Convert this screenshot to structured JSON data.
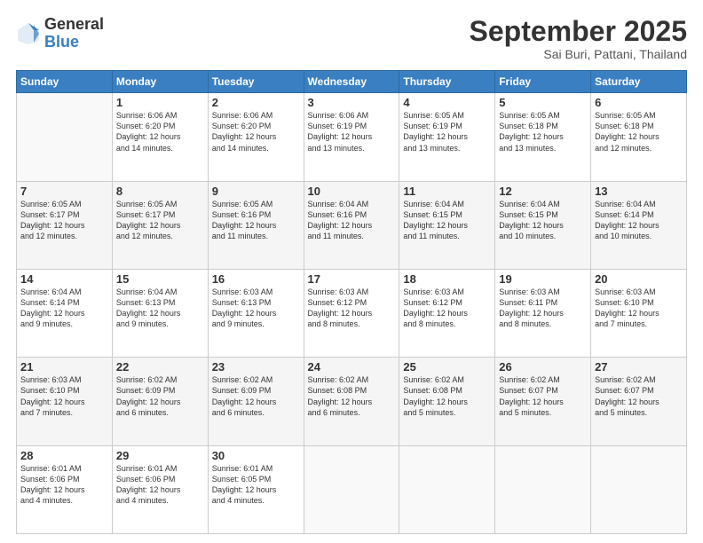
{
  "logo": {
    "general": "General",
    "blue": "Blue"
  },
  "header": {
    "month": "September 2025",
    "location": "Sai Buri, Pattani, Thailand"
  },
  "weekdays": [
    "Sunday",
    "Monday",
    "Tuesday",
    "Wednesday",
    "Thursday",
    "Friday",
    "Saturday"
  ],
  "weeks": [
    [
      {
        "day": null
      },
      {
        "day": 1,
        "sunrise": "6:06 AM",
        "sunset": "6:20 PM",
        "daylight": "12 hours and 14 minutes."
      },
      {
        "day": 2,
        "sunrise": "6:06 AM",
        "sunset": "6:20 PM",
        "daylight": "12 hours and 14 minutes."
      },
      {
        "day": 3,
        "sunrise": "6:06 AM",
        "sunset": "6:19 PM",
        "daylight": "12 hours and 13 minutes."
      },
      {
        "day": 4,
        "sunrise": "6:05 AM",
        "sunset": "6:19 PM",
        "daylight": "12 hours and 13 minutes."
      },
      {
        "day": 5,
        "sunrise": "6:05 AM",
        "sunset": "6:18 PM",
        "daylight": "12 hours and 13 minutes."
      },
      {
        "day": 6,
        "sunrise": "6:05 AM",
        "sunset": "6:18 PM",
        "daylight": "12 hours and 12 minutes."
      }
    ],
    [
      {
        "day": 7,
        "sunrise": "6:05 AM",
        "sunset": "6:17 PM",
        "daylight": "12 hours and 12 minutes."
      },
      {
        "day": 8,
        "sunrise": "6:05 AM",
        "sunset": "6:17 PM",
        "daylight": "12 hours and 12 minutes."
      },
      {
        "day": 9,
        "sunrise": "6:05 AM",
        "sunset": "6:16 PM",
        "daylight": "12 hours and 11 minutes."
      },
      {
        "day": 10,
        "sunrise": "6:04 AM",
        "sunset": "6:16 PM",
        "daylight": "12 hours and 11 minutes."
      },
      {
        "day": 11,
        "sunrise": "6:04 AM",
        "sunset": "6:15 PM",
        "daylight": "12 hours and 11 minutes."
      },
      {
        "day": 12,
        "sunrise": "6:04 AM",
        "sunset": "6:15 PM",
        "daylight": "12 hours and 10 minutes."
      },
      {
        "day": 13,
        "sunrise": "6:04 AM",
        "sunset": "6:14 PM",
        "daylight": "12 hours and 10 minutes."
      }
    ],
    [
      {
        "day": 14,
        "sunrise": "6:04 AM",
        "sunset": "6:14 PM",
        "daylight": "12 hours and 9 minutes."
      },
      {
        "day": 15,
        "sunrise": "6:04 AM",
        "sunset": "6:13 PM",
        "daylight": "12 hours and 9 minutes."
      },
      {
        "day": 16,
        "sunrise": "6:03 AM",
        "sunset": "6:13 PM",
        "daylight": "12 hours and 9 minutes."
      },
      {
        "day": 17,
        "sunrise": "6:03 AM",
        "sunset": "6:12 PM",
        "daylight": "12 hours and 8 minutes."
      },
      {
        "day": 18,
        "sunrise": "6:03 AM",
        "sunset": "6:12 PM",
        "daylight": "12 hours and 8 minutes."
      },
      {
        "day": 19,
        "sunrise": "6:03 AM",
        "sunset": "6:11 PM",
        "daylight": "12 hours and 8 minutes."
      },
      {
        "day": 20,
        "sunrise": "6:03 AM",
        "sunset": "6:10 PM",
        "daylight": "12 hours and 7 minutes."
      }
    ],
    [
      {
        "day": 21,
        "sunrise": "6:03 AM",
        "sunset": "6:10 PM",
        "daylight": "12 hours and 7 minutes."
      },
      {
        "day": 22,
        "sunrise": "6:02 AM",
        "sunset": "6:09 PM",
        "daylight": "12 hours and 6 minutes."
      },
      {
        "day": 23,
        "sunrise": "6:02 AM",
        "sunset": "6:09 PM",
        "daylight": "12 hours and 6 minutes."
      },
      {
        "day": 24,
        "sunrise": "6:02 AM",
        "sunset": "6:08 PM",
        "daylight": "12 hours and 6 minutes."
      },
      {
        "day": 25,
        "sunrise": "6:02 AM",
        "sunset": "6:08 PM",
        "daylight": "12 hours and 5 minutes."
      },
      {
        "day": 26,
        "sunrise": "6:02 AM",
        "sunset": "6:07 PM",
        "daylight": "12 hours and 5 minutes."
      },
      {
        "day": 27,
        "sunrise": "6:02 AM",
        "sunset": "6:07 PM",
        "daylight": "12 hours and 5 minutes."
      }
    ],
    [
      {
        "day": 28,
        "sunrise": "6:01 AM",
        "sunset": "6:06 PM",
        "daylight": "12 hours and 4 minutes."
      },
      {
        "day": 29,
        "sunrise": "6:01 AM",
        "sunset": "6:06 PM",
        "daylight": "12 hours and 4 minutes."
      },
      {
        "day": 30,
        "sunrise": "6:01 AM",
        "sunset": "6:05 PM",
        "daylight": "12 hours and 4 minutes."
      },
      {
        "day": null
      },
      {
        "day": null
      },
      {
        "day": null
      },
      {
        "day": null
      }
    ]
  ]
}
